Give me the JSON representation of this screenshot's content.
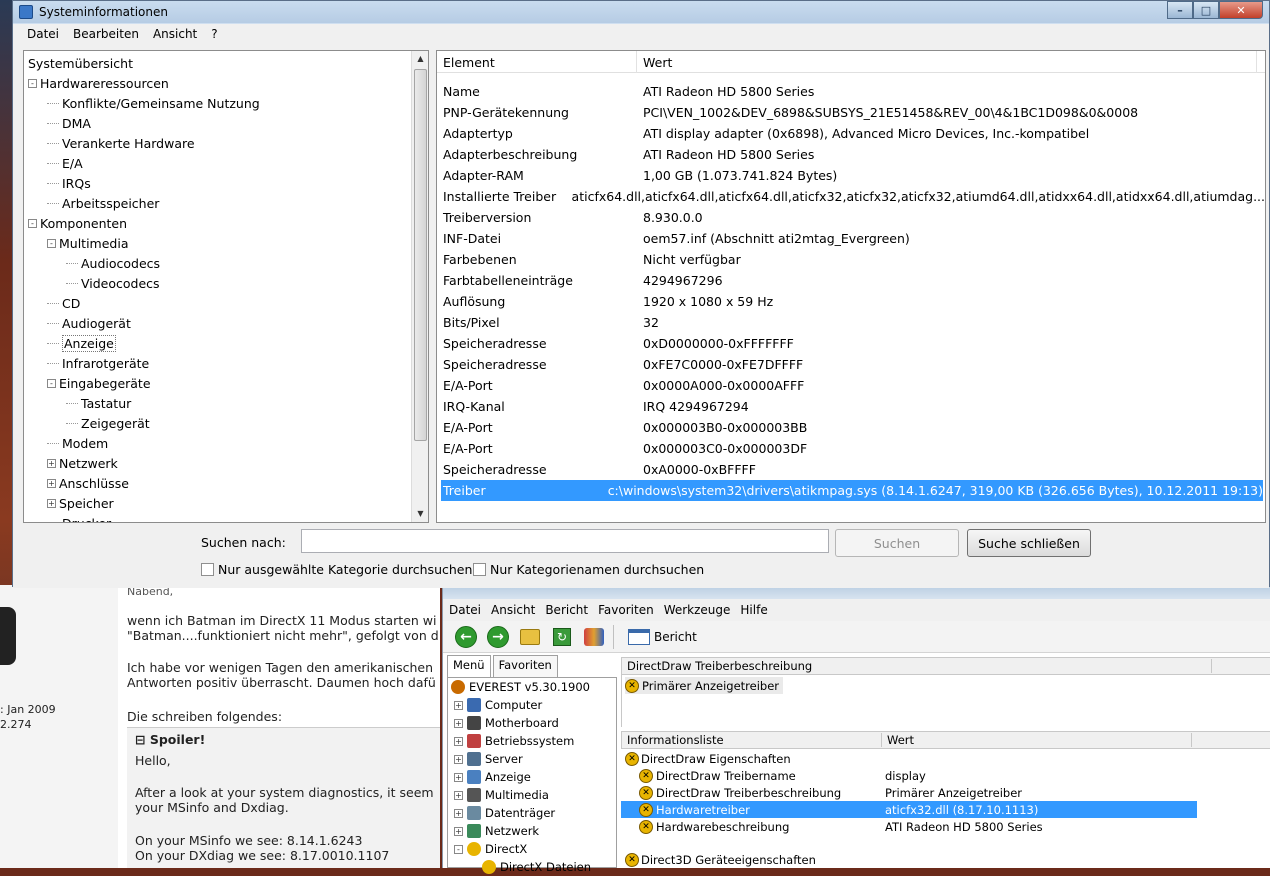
{
  "sysinfo": {
    "title": "Systeminformationen",
    "menu": [
      "Datei",
      "Bearbeiten",
      "Ansicht",
      "?"
    ],
    "win_buttons": {
      "minimize": "–",
      "maximize": "□",
      "close": "✕"
    },
    "tree": [
      {
        "label": "Systemübersicht",
        "level": 0,
        "expander": ""
      },
      {
        "label": "Hardwareressourcen",
        "level": 0,
        "expander": "-"
      },
      {
        "label": "Konflikte/Gemeinsame Nutzung",
        "level": 1,
        "expander": ""
      },
      {
        "label": "DMA",
        "level": 1,
        "expander": ""
      },
      {
        "label": "Verankerte Hardware",
        "level": 1,
        "expander": ""
      },
      {
        "label": "E/A",
        "level": 1,
        "expander": ""
      },
      {
        "label": "IRQs",
        "level": 1,
        "expander": ""
      },
      {
        "label": "Arbeitsspeicher",
        "level": 1,
        "expander": ""
      },
      {
        "label": "Komponenten",
        "level": 0,
        "expander": "-"
      },
      {
        "label": "Multimedia",
        "level": 1,
        "expander": "-"
      },
      {
        "label": "Audiocodecs",
        "level": 2,
        "expander": ""
      },
      {
        "label": "Videocodecs",
        "level": 2,
        "expander": ""
      },
      {
        "label": "CD",
        "level": 1,
        "expander": ""
      },
      {
        "label": "Audiogerät",
        "level": 1,
        "expander": ""
      },
      {
        "label": "Anzeige",
        "level": 1,
        "expander": "",
        "selected": true
      },
      {
        "label": "Infrarotgeräte",
        "level": 1,
        "expander": ""
      },
      {
        "label": "Eingabegeräte",
        "level": 1,
        "expander": "-"
      },
      {
        "label": "Tastatur",
        "level": 2,
        "expander": ""
      },
      {
        "label": "Zeigegerät",
        "level": 2,
        "expander": ""
      },
      {
        "label": "Modem",
        "level": 1,
        "expander": ""
      },
      {
        "label": "Netzwerk",
        "level": 1,
        "expander": "+"
      },
      {
        "label": "Anschlüsse",
        "level": 1,
        "expander": "+"
      },
      {
        "label": "Speicher",
        "level": 1,
        "expander": "+"
      },
      {
        "label": "Drucker",
        "level": 1,
        "expander": ""
      }
    ],
    "list_headers": [
      "Element",
      "Wert"
    ],
    "list_rows": [
      [
        "Name",
        "ATI Radeon HD 5800 Series"
      ],
      [
        "PNP-Gerätekennung",
        "PCI\\VEN_1002&DEV_6898&SUBSYS_21E51458&REV_00\\4&1BC1D098&0&0008"
      ],
      [
        "Adaptertyp",
        "ATI display adapter (0x6898), Advanced Micro Devices, Inc.-kompatibel"
      ],
      [
        "Adapterbeschreibung",
        "ATI Radeon HD 5800 Series"
      ],
      [
        "Adapter-RAM",
        "1,00 GB (1.073.741.824 Bytes)"
      ],
      [
        "Installierte Treiber",
        "aticfx64.dll,aticfx64.dll,aticfx64.dll,aticfx32,aticfx32,aticfx32,atiumd64.dll,atidxx64.dll,atidxx64.dll,atiumdag..."
      ],
      [
        "Treiberversion",
        "8.930.0.0"
      ],
      [
        "INF-Datei",
        "oem57.inf (Abschnitt ati2mtag_Evergreen)"
      ],
      [
        "Farbebenen",
        "Nicht verfügbar"
      ],
      [
        "Farbtabelleneinträge",
        "4294967296"
      ],
      [
        "Auflösung",
        "1920 x 1080 x 59 Hz"
      ],
      [
        "Bits/Pixel",
        "32"
      ],
      [
        "Speicheradresse",
        "0xD0000000-0xFFFFFFF"
      ],
      [
        "Speicheradresse",
        "0xFE7C0000-0xFE7DFFFF"
      ],
      [
        "E/A-Port",
        "0x0000A000-0x0000AFFF"
      ],
      [
        "IRQ-Kanal",
        "IRQ 4294967294"
      ],
      [
        "E/A-Port",
        "0x000003B0-0x000003BB"
      ],
      [
        "E/A-Port",
        "0x000003C0-0x000003DF"
      ],
      [
        "Speicheradresse",
        "0xA0000-0xBFFFF"
      ],
      [
        "Treiber",
        "c:\\windows\\system32\\drivers\\atikmpag.sys (8.14.1.6247, 319,00 KB (326.656 Bytes), 10.12.2011 19:13)"
      ]
    ],
    "selected_row": 19,
    "search_label": "Suchen nach:",
    "search_value": "",
    "search_button": "Suchen",
    "close_search_button": "Suche schließen",
    "check_selected_category": "Nur ausgewählte Kategorie durchsuchen",
    "check_category_names": "Nur Kategorienamen durchsuchen"
  },
  "forum": {
    "greeting": "Nabend,",
    "line1": "wenn ich Batman im DirectX 11 Modus starten wi",
    "line2": "\"Batman....funktioniert nicht mehr\", gefolgt von d",
    "line3": "Ich habe vor wenigen Tagen den amerikanischen",
    "line4": "Antworten positiv überrascht. Daumen hoch dafü",
    "line5": "Die schreiben folgendes:",
    "spoiler_label": "Spoiler!",
    "spoiler_expander": "⊟",
    "sp1": "Hello,",
    "sp2": "After a look at your system diagnostics, it seem",
    "sp3": "your MSinfo and Dxdiag.",
    "sp4": "On your MSinfo we see: 8.14.1.6243",
    "sp5": "On your DXdiag we see: 8.17.0010.1107",
    "joined": ": Jan 2009",
    "posts": "2.274"
  },
  "everest": {
    "menu": [
      "Datei",
      "Ansicht",
      "Bericht",
      "Favoriten",
      "Werkzeuge",
      "Hilfe"
    ],
    "report_label": "Bericht",
    "tabs": [
      "Menü",
      "Favoriten"
    ],
    "tree": [
      {
        "label": "EVEREST v5.30.1900",
        "expander": ""
      },
      {
        "label": "Computer",
        "expander": "+"
      },
      {
        "label": "Motherboard",
        "expander": "+"
      },
      {
        "label": "Betriebssystem",
        "expander": "+"
      },
      {
        "label": "Server",
        "expander": "+"
      },
      {
        "label": "Anzeige",
        "expander": "+"
      },
      {
        "label": "Multimedia",
        "expander": "+"
      },
      {
        "label": "Datenträger",
        "expander": "+"
      },
      {
        "label": "Netzwerk",
        "expander": "+"
      },
      {
        "label": "DirectX",
        "expander": "-"
      },
      {
        "label": "DirectX Dateien",
        "expander": ""
      }
    ],
    "desc_header": "DirectDraw Treiberbeschreibung",
    "desc_item": "Primärer Anzeigetreiber",
    "info_headers": [
      "Informationsliste",
      "Wert"
    ],
    "group1": "DirectDraw Eigenschaften",
    "props": [
      [
        "DirectDraw Treibername",
        "display"
      ],
      [
        "DirectDraw Treiberbeschreibung",
        "Primärer Anzeigetreiber"
      ],
      [
        "Hardwaretreiber",
        "aticfx32.dll (8.17.10.1113)"
      ],
      [
        "Hardwarebeschreibung",
        "ATI Radeon HD 5800 Series"
      ]
    ],
    "group2": "Direct3D Geräteeigenschaften"
  }
}
